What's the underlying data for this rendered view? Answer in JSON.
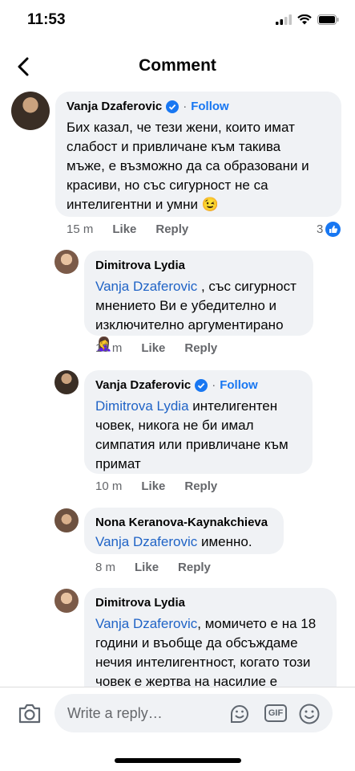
{
  "status": {
    "time": "11:53"
  },
  "header": {
    "title": "Comment"
  },
  "comments": [
    {
      "author": "Vanja Dzaferovic",
      "follow": "Follow",
      "dot": "·",
      "text": "Бих казал, че тези жени, които имат\nслабост и привличане към такива\nмъже, е възможно да са образовани и\nкрасиви, но със сигурност не са\nинтелигентни и умни 😉",
      "time": "15 m",
      "like": "Like",
      "reply": "Reply",
      "reactions": "3"
    },
    {
      "author": "Dimitrova Lydia",
      "mention": "Vanja Dzaferovic",
      "text": " , със сигурност\nмнението Ви е убедително и\nизключително аргументирано 🤦‍♀️",
      "time": "13 m",
      "like": "Like",
      "reply": "Reply"
    },
    {
      "author": "Vanja Dzaferovic",
      "follow": "Follow",
      "dot": "·",
      "mention": "Dimitrova Lydia",
      "text": " интелигентен\nчовек, никога не би имал\nсимпатия или привличане към\nпримат",
      "time": "10 m",
      "like": "Like",
      "reply": "Reply"
    },
    {
      "author": "Nona Keranova-Kaynakchieva",
      "mention": "Vanja Dzaferovic",
      "text": " именно.",
      "time": "8 m",
      "like": "Like",
      "reply": "Reply"
    },
    {
      "author": "Dimitrova Lydia",
      "mention": "Vanja Dzaferovic",
      "text": ", момичето е на 18\nгодини и въобще да обсъждаме\nнечия интелигентност, когато този\nчовек е жертва на насилие е",
      "time": "",
      "like": "",
      "reply": ""
    }
  ],
  "composer": {
    "placeholder": "Write a reply…",
    "gif_label": "GIF"
  },
  "colors": {
    "accent": "#1877f2",
    "bubble": "#f0f2f5",
    "meta": "#65676b"
  }
}
